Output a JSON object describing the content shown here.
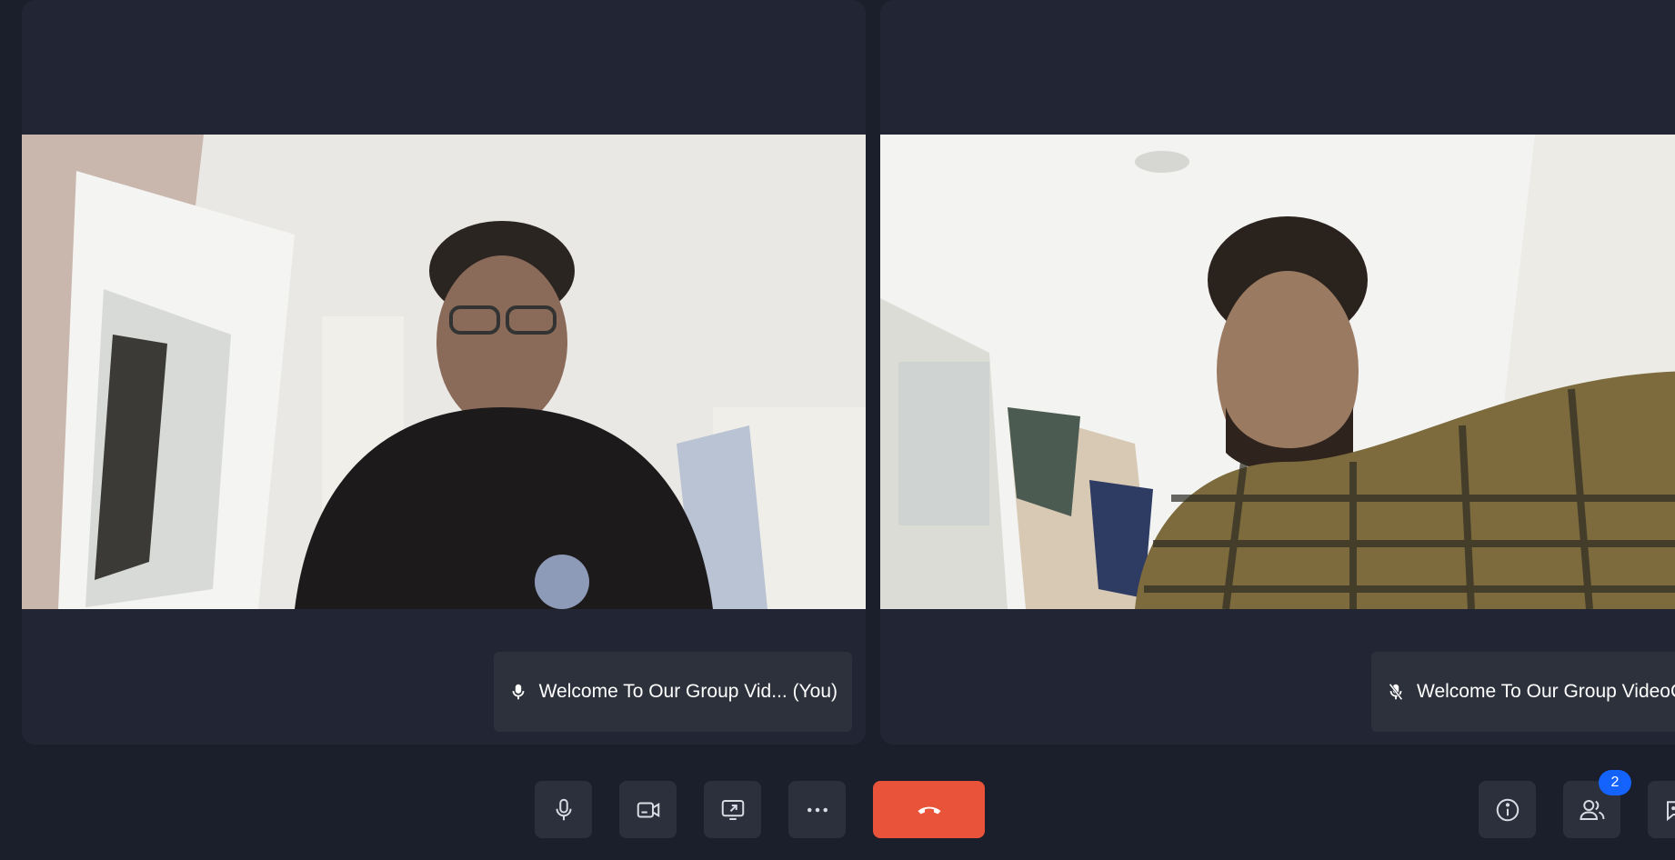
{
  "participants": [
    {
      "name_label": "Welcome To Our Group Vid... (You)",
      "mic_icon": "mic-icon",
      "mic_state": "on"
    },
    {
      "name_label": "Welcome To Our Group VideoC",
      "mic_icon": "mic-off-icon",
      "mic_state": "muted"
    }
  ],
  "controls": {
    "mic": {
      "icon": "mic-icon"
    },
    "camera": {
      "icon": "video-camera-icon"
    },
    "share": {
      "icon": "screen-share-icon"
    },
    "more": {
      "icon": "more-dots-icon"
    },
    "end_call": {
      "icon": "phone-hangup-icon",
      "color": "#e8533a"
    },
    "info": {
      "icon": "info-icon"
    },
    "participants": {
      "icon": "people-icon",
      "badge": "2",
      "badge_color": "#1463ff"
    },
    "chat": {
      "icon": "chat-icon"
    }
  },
  "colors": {
    "background": "#1b1f2b",
    "tile": "#222634",
    "name_tag": "#2d313c",
    "control_button": "#2c303d"
  }
}
